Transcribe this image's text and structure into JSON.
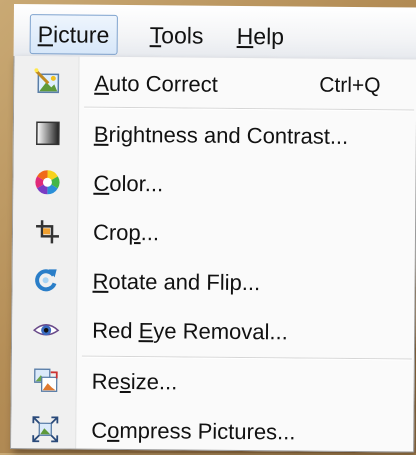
{
  "menubar": {
    "items": [
      {
        "label": "Picture",
        "mnemonic": "P",
        "rest": "icture",
        "state": "open"
      },
      {
        "label": "Tools",
        "mnemonic": "T",
        "rest": "ools"
      },
      {
        "label": "Help",
        "mnemonic": "H",
        "rest": "elp"
      }
    ]
  },
  "picture_menu": {
    "items": [
      {
        "label": "Auto Correct",
        "pre": "",
        "mnemonic": "A",
        "post": "uto Correct",
        "shortcut": "Ctrl+Q",
        "icon": "auto-correct-icon"
      },
      {
        "label": "Brightness and Contrast...",
        "pre": "",
        "mnemonic": "B",
        "post": "rightness and Contrast...",
        "icon": "brightness-contrast-icon"
      },
      {
        "label": "Color...",
        "pre": "",
        "mnemonic": "C",
        "post": "olor...",
        "icon": "color-wheel-icon"
      },
      {
        "label": "Crop...",
        "pre": "Cro",
        "mnemonic": "p",
        "post": "...",
        "icon": "crop-icon"
      },
      {
        "label": "Rotate and Flip...",
        "pre": "",
        "mnemonic": "R",
        "post": "otate and Flip...",
        "icon": "rotate-flip-icon"
      },
      {
        "label": "Red Eye Removal...",
        "pre": "Red ",
        "mnemonic": "E",
        "post": "ye Removal...",
        "icon": "red-eye-icon"
      },
      {
        "label": "Resize...",
        "pre": "Re",
        "mnemonic": "s",
        "post": "ize...",
        "icon": "resize-icon"
      },
      {
        "label": "Compress Pictures...",
        "pre": "C",
        "mnemonic": "o",
        "post": "mpress Pictures...",
        "icon": "compress-pictures-icon"
      }
    ]
  }
}
